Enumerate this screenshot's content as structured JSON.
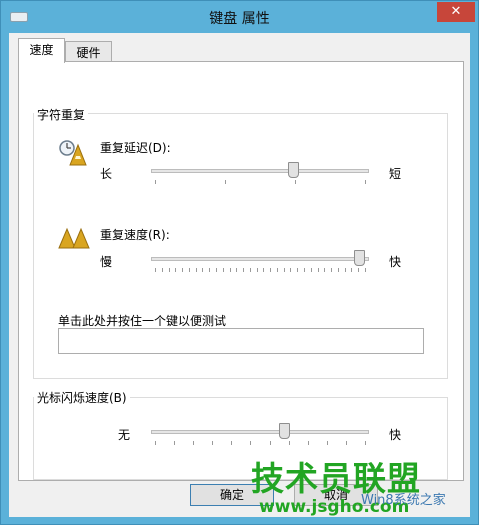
{
  "window": {
    "title": "键盘 属性",
    "close_glyph": "✕"
  },
  "tabs": [
    {
      "label": "速度",
      "active": true
    },
    {
      "label": "硬件",
      "active": false
    }
  ],
  "repeat_group": {
    "legend": "字符重复",
    "delay": {
      "label": "重复延迟(D):",
      "min_label": "长",
      "max_label": "短",
      "value_fraction": 0.66
    },
    "rate": {
      "label": "重复速度(R):",
      "min_label": "慢",
      "max_label": "快",
      "value_fraction": 0.98
    },
    "test_label": "单击此处并按住一个键以便测试",
    "test_value": ""
  },
  "cursor_group": {
    "legend": "光标闪烁速度(B)",
    "min_label": "无",
    "max_label": "快",
    "value_fraction": 0.62
  },
  "buttons": {
    "ok": "确定",
    "cancel": "取消"
  },
  "watermark": {
    "line1": "技术员联盟",
    "line2": "www.jsgho.com",
    "overlay": "Win8系统之家"
  },
  "colors": {
    "close": "#c7463a",
    "watermark_green": "#20a020",
    "title_bg": "#5bb1d9"
  }
}
